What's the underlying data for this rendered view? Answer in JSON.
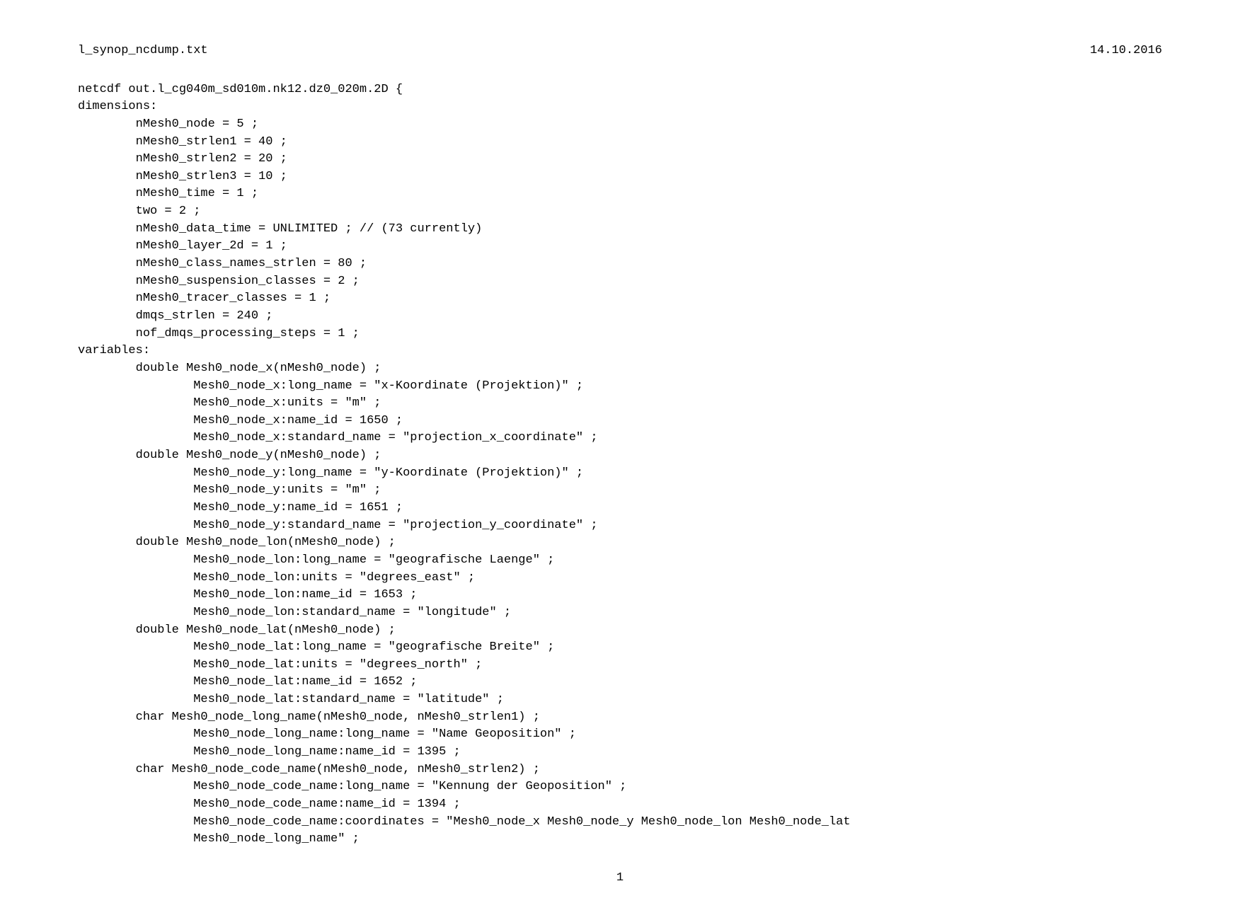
{
  "header": {
    "filename": "l_synop_ncdump.txt",
    "date": "14.10.2016"
  },
  "lines": [
    "netcdf out.l_cg040m_sd010m.nk12.dz0_020m.2D {",
    "dimensions:",
    "        nMesh0_node = 5 ;",
    "        nMesh0_strlen1 = 40 ;",
    "        nMesh0_strlen2 = 20 ;",
    "        nMesh0_strlen3 = 10 ;",
    "        nMesh0_time = 1 ;",
    "        two = 2 ;",
    "        nMesh0_data_time = UNLIMITED ; // (73 currently)",
    "        nMesh0_layer_2d = 1 ;",
    "        nMesh0_class_names_strlen = 80 ;",
    "        nMesh0_suspension_classes = 2 ;",
    "        nMesh0_tracer_classes = 1 ;",
    "        dmqs_strlen = 240 ;",
    "        nof_dmqs_processing_steps = 1 ;",
    "variables:",
    "        double Mesh0_node_x(nMesh0_node) ;",
    "                Mesh0_node_x:long_name = \"x-Koordinate (Projektion)\" ;",
    "                Mesh0_node_x:units = \"m\" ;",
    "                Mesh0_node_x:name_id = 1650 ;",
    "                Mesh0_node_x:standard_name = \"projection_x_coordinate\" ;",
    "        double Mesh0_node_y(nMesh0_node) ;",
    "                Mesh0_node_y:long_name = \"y-Koordinate (Projektion)\" ;",
    "                Mesh0_node_y:units = \"m\" ;",
    "                Mesh0_node_y:name_id = 1651 ;",
    "                Mesh0_node_y:standard_name = \"projection_y_coordinate\" ;",
    "        double Mesh0_node_lon(nMesh0_node) ;",
    "                Mesh0_node_lon:long_name = \"geografische Laenge\" ;",
    "                Mesh0_node_lon:units = \"degrees_east\" ;",
    "                Mesh0_node_lon:name_id = 1653 ;",
    "                Mesh0_node_lon:standard_name = \"longitude\" ;",
    "        double Mesh0_node_lat(nMesh0_node) ;",
    "                Mesh0_node_lat:long_name = \"geografische Breite\" ;",
    "                Mesh0_node_lat:units = \"degrees_north\" ;",
    "                Mesh0_node_lat:name_id = 1652 ;",
    "                Mesh0_node_lat:standard_name = \"latitude\" ;",
    "        char Mesh0_node_long_name(nMesh0_node, nMesh0_strlen1) ;",
    "                Mesh0_node_long_name:long_name = \"Name Geoposition\" ;",
    "                Mesh0_node_long_name:name_id = 1395 ;",
    "        char Mesh0_node_code_name(nMesh0_node, nMesh0_strlen2) ;",
    "                Mesh0_node_code_name:long_name = \"Kennung der Geoposition\" ;",
    "                Mesh0_node_code_name:name_id = 1394 ;",
    "                Mesh0_node_code_name:coordinates = \"Mesh0_node_x Mesh0_node_y Mesh0_node_lon Mesh0_node_lat",
    "                Mesh0_node_long_name\" ;"
  ],
  "footer": {
    "page_number": "1"
  }
}
